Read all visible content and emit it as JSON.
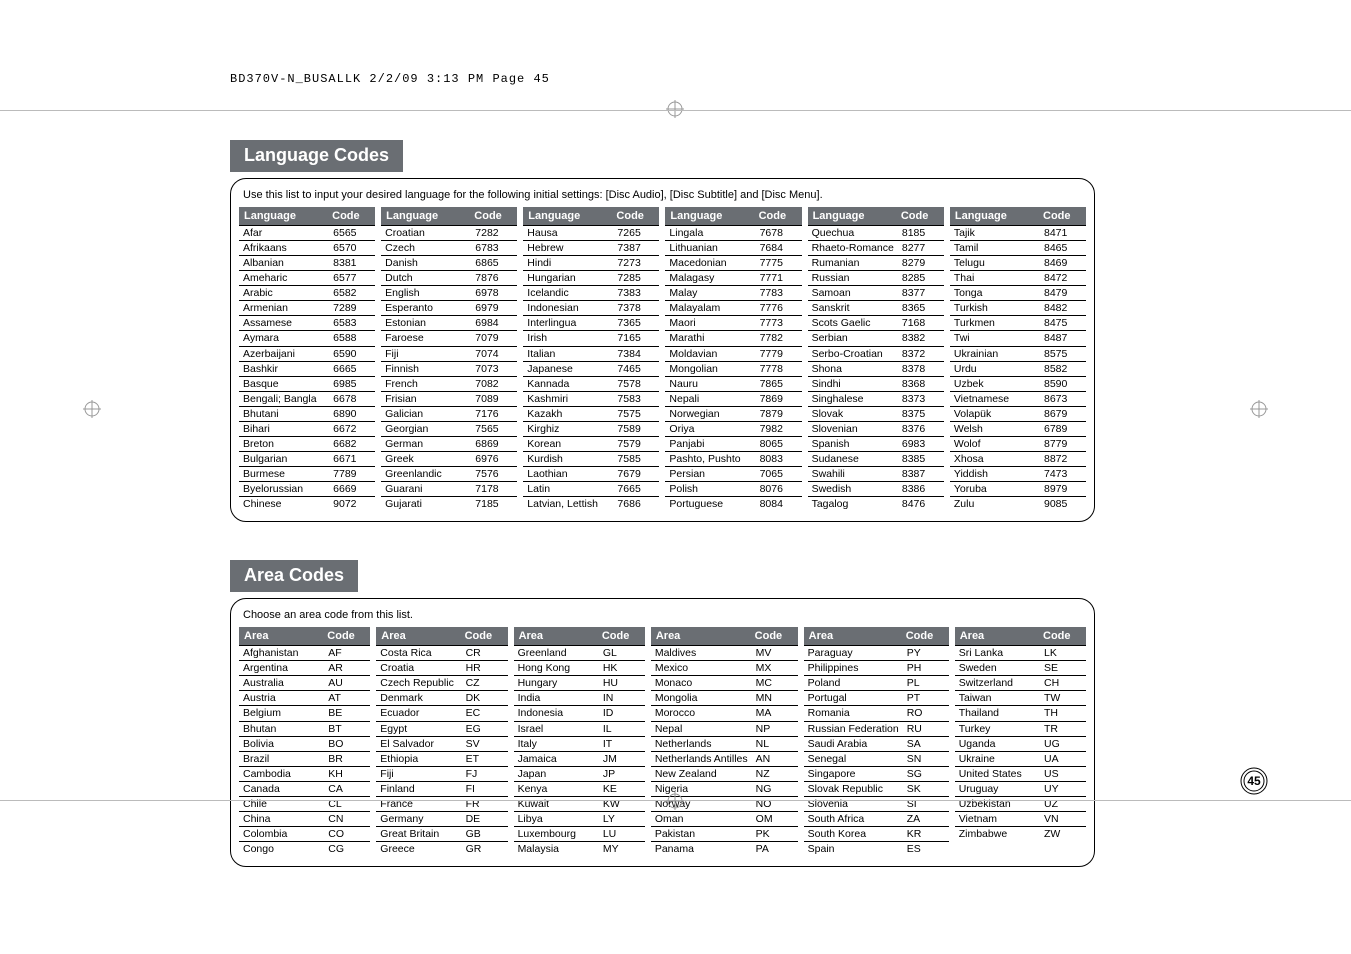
{
  "print_header": "BD370V-N_BUSALLK  2/2/09  3:13 PM  Page 45",
  "page_number": "45",
  "lang_section": {
    "title": "Language Codes",
    "intro": "Use this list to input your desired language for the following initial settings: [Disc Audio], [Disc Subtitle] and [Disc Menu].",
    "header": {
      "c1": "Language",
      "c2": "Code"
    },
    "columns": [
      [
        [
          "Afar",
          "6565"
        ],
        [
          "Afrikaans",
          "6570"
        ],
        [
          "Albanian",
          "8381"
        ],
        [
          "Ameharic",
          "6577"
        ],
        [
          "Arabic",
          "6582"
        ],
        [
          "Armenian",
          "7289"
        ],
        [
          "Assamese",
          "6583"
        ],
        [
          "Aymara",
          "6588"
        ],
        [
          "Azerbaijani",
          "6590"
        ],
        [
          "Bashkir",
          "6665"
        ],
        [
          "Basque",
          "6985"
        ],
        [
          "Bengali; Bangla",
          "6678"
        ],
        [
          "Bhutani",
          "6890"
        ],
        [
          "Bihari",
          "6672"
        ],
        [
          "Breton",
          "6682"
        ],
        [
          "Bulgarian",
          "6671"
        ],
        [
          "Burmese",
          "7789"
        ],
        [
          "Byelorussian",
          "6669"
        ],
        [
          "Chinese",
          "9072"
        ]
      ],
      [
        [
          "Croatian",
          "7282"
        ],
        [
          "Czech",
          "6783"
        ],
        [
          "Danish",
          "6865"
        ],
        [
          "Dutch",
          "7876"
        ],
        [
          "English",
          "6978"
        ],
        [
          "Esperanto",
          "6979"
        ],
        [
          "Estonian",
          "6984"
        ],
        [
          "Faroese",
          "7079"
        ],
        [
          "Fiji",
          "7074"
        ],
        [
          "Finnish",
          "7073"
        ],
        [
          "French",
          "7082"
        ],
        [
          "Frisian",
          "7089"
        ],
        [
          "Galician",
          "7176"
        ],
        [
          "Georgian",
          "7565"
        ],
        [
          "German",
          "6869"
        ],
        [
          "Greek",
          "6976"
        ],
        [
          "Greenlandic",
          "7576"
        ],
        [
          "Guarani",
          "7178"
        ],
        [
          "Gujarati",
          "7185"
        ]
      ],
      [
        [
          "Hausa",
          "7265"
        ],
        [
          "Hebrew",
          "7387"
        ],
        [
          "Hindi",
          "7273"
        ],
        [
          "Hungarian",
          "7285"
        ],
        [
          "Icelandic",
          "7383"
        ],
        [
          "Indonesian",
          "7378"
        ],
        [
          "Interlingua",
          "7365"
        ],
        [
          "Irish",
          "7165"
        ],
        [
          "Italian",
          "7384"
        ],
        [
          "Japanese",
          "7465"
        ],
        [
          "Kannada",
          "7578"
        ],
        [
          "Kashmiri",
          "7583"
        ],
        [
          "Kazakh",
          "7575"
        ],
        [
          "Kirghiz",
          "7589"
        ],
        [
          "Korean",
          "7579"
        ],
        [
          "Kurdish",
          "7585"
        ],
        [
          "Laothian",
          "7679"
        ],
        [
          "Latin",
          "7665"
        ],
        [
          "Latvian, Lettish",
          "7686"
        ]
      ],
      [
        [
          "Lingala",
          "7678"
        ],
        [
          "Lithuanian",
          "7684"
        ],
        [
          "Macedonian",
          "7775"
        ],
        [
          "Malagasy",
          "7771"
        ],
        [
          "Malay",
          "7783"
        ],
        [
          "Malayalam",
          "7776"
        ],
        [
          "Maori",
          "7773"
        ],
        [
          "Marathi",
          "7782"
        ],
        [
          "Moldavian",
          "7779"
        ],
        [
          "Mongolian",
          "7778"
        ],
        [
          "Nauru",
          "7865"
        ],
        [
          "Nepali",
          "7869"
        ],
        [
          "Norwegian",
          "7879"
        ],
        [
          "Oriya",
          "7982"
        ],
        [
          "Panjabi",
          "8065"
        ],
        [
          "Pashto, Pushto",
          "8083"
        ],
        [
          "Persian",
          "7065"
        ],
        [
          "Polish",
          "8076"
        ],
        [
          "Portuguese",
          "8084"
        ]
      ],
      [
        [
          "Quechua",
          "8185"
        ],
        [
          "Rhaeto-Romance",
          "8277"
        ],
        [
          "Rumanian",
          "8279"
        ],
        [
          "Russian",
          "8285"
        ],
        [
          "Samoan",
          "8377"
        ],
        [
          "Sanskrit",
          "8365"
        ],
        [
          "Scots Gaelic",
          "7168"
        ],
        [
          "Serbian",
          "8382"
        ],
        [
          "Serbo-Croatian",
          "8372"
        ],
        [
          "Shona",
          "8378"
        ],
        [
          "Sindhi",
          "8368"
        ],
        [
          "Singhalese",
          "8373"
        ],
        [
          "Slovak",
          "8375"
        ],
        [
          "Slovenian",
          "8376"
        ],
        [
          "Spanish",
          "6983"
        ],
        [
          "Sudanese",
          "8385"
        ],
        [
          "Swahili",
          "8387"
        ],
        [
          "Swedish",
          "8386"
        ],
        [
          "Tagalog",
          "8476"
        ]
      ],
      [
        [
          "Tajik",
          "8471"
        ],
        [
          "Tamil",
          "8465"
        ],
        [
          "Telugu",
          "8469"
        ],
        [
          "Thai",
          "8472"
        ],
        [
          "Tonga",
          "8479"
        ],
        [
          "Turkish",
          "8482"
        ],
        [
          "Turkmen",
          "8475"
        ],
        [
          "Twi",
          "8487"
        ],
        [
          "Ukrainian",
          "8575"
        ],
        [
          "Urdu",
          "8582"
        ],
        [
          "Uzbek",
          "8590"
        ],
        [
          "Vietnamese",
          "8673"
        ],
        [
          "Volapük",
          "8679"
        ],
        [
          "Welsh",
          "6789"
        ],
        [
          "Wolof",
          "8779"
        ],
        [
          "Xhosa",
          "8872"
        ],
        [
          "Yiddish",
          "7473"
        ],
        [
          "Yoruba",
          "8979"
        ],
        [
          "Zulu",
          "9085"
        ]
      ]
    ]
  },
  "area_section": {
    "title": "Area Codes",
    "intro": "Choose an area code from this list.",
    "header": {
      "c1": "Area",
      "c2": "Code"
    },
    "columns": [
      [
        [
          "Afghanistan",
          "AF"
        ],
        [
          "Argentina",
          "AR"
        ],
        [
          "Australia",
          "AU"
        ],
        [
          "Austria",
          "AT"
        ],
        [
          "Belgium",
          "BE"
        ],
        [
          "Bhutan",
          "BT"
        ],
        [
          "Bolivia",
          "BO"
        ],
        [
          "Brazil",
          "BR"
        ],
        [
          "Cambodia",
          "KH"
        ],
        [
          "Canada",
          "CA"
        ],
        [
          "Chile",
          "CL"
        ],
        [
          "China",
          "CN"
        ],
        [
          "Colombia",
          "CO"
        ],
        [
          "Congo",
          "CG"
        ]
      ],
      [
        [
          "Costa Rica",
          "CR"
        ],
        [
          "Croatia",
          "HR"
        ],
        [
          "Czech Republic",
          "CZ"
        ],
        [
          "Denmark",
          "DK"
        ],
        [
          "Ecuador",
          "EC"
        ],
        [
          "Egypt",
          "EG"
        ],
        [
          "El Salvador",
          "SV"
        ],
        [
          "Ethiopia",
          "ET"
        ],
        [
          "Fiji",
          "FJ"
        ],
        [
          "Finland",
          "FI"
        ],
        [
          "France",
          "FR"
        ],
        [
          "Germany",
          "DE"
        ],
        [
          "Great Britain",
          "GB"
        ],
        [
          "Greece",
          "GR"
        ]
      ],
      [
        [
          "Greenland",
          "GL"
        ],
        [
          "Hong Kong",
          "HK"
        ],
        [
          "Hungary",
          "HU"
        ],
        [
          "India",
          "IN"
        ],
        [
          "Indonesia",
          "ID"
        ],
        [
          "Israel",
          "IL"
        ],
        [
          "Italy",
          "IT"
        ],
        [
          "Jamaica",
          "JM"
        ],
        [
          "Japan",
          "JP"
        ],
        [
          "Kenya",
          "KE"
        ],
        [
          "Kuwait",
          "KW"
        ],
        [
          "Libya",
          "LY"
        ],
        [
          "Luxembourg",
          "LU"
        ],
        [
          "Malaysia",
          "MY"
        ]
      ],
      [
        [
          "Maldives",
          "MV"
        ],
        [
          "Mexico",
          "MX"
        ],
        [
          "Monaco",
          "MC"
        ],
        [
          "Mongolia",
          "MN"
        ],
        [
          "Morocco",
          "MA"
        ],
        [
          "Nepal",
          "NP"
        ],
        [
          "Netherlands",
          "NL"
        ],
        [
          "Netherlands Antilles",
          "AN"
        ],
        [
          "New Zealand",
          "NZ"
        ],
        [
          "Nigeria",
          "NG"
        ],
        [
          "Norway",
          "NO"
        ],
        [
          "Oman",
          "OM"
        ],
        [
          "Pakistan",
          "PK"
        ],
        [
          "Panama",
          "PA"
        ]
      ],
      [
        [
          "Paraguay",
          "PY"
        ],
        [
          "Philippines",
          "PH"
        ],
        [
          "Poland",
          "PL"
        ],
        [
          "Portugal",
          "PT"
        ],
        [
          "Romania",
          "RO"
        ],
        [
          "Russian Federation",
          "RU"
        ],
        [
          "Saudi Arabia",
          "SA"
        ],
        [
          "Senegal",
          "SN"
        ],
        [
          "Singapore",
          "SG"
        ],
        [
          "Slovak Republic",
          "SK"
        ],
        [
          "Slovenia",
          "SI"
        ],
        [
          "South Africa",
          "ZA"
        ],
        [
          "South Korea",
          "KR"
        ],
        [
          "Spain",
          "ES"
        ]
      ],
      [
        [
          "Sri Lanka",
          "LK"
        ],
        [
          "Sweden",
          "SE"
        ],
        [
          "Switzerland",
          "CH"
        ],
        [
          "Taiwan",
          "TW"
        ],
        [
          "Thailand",
          "TH"
        ],
        [
          "Turkey",
          "TR"
        ],
        [
          "Uganda",
          "UG"
        ],
        [
          "Ukraine",
          "UA"
        ],
        [
          "United States",
          "US"
        ],
        [
          "Uruguay",
          "UY"
        ],
        [
          "Uzbekistan",
          "UZ"
        ],
        [
          "Vietnam",
          "VN"
        ],
        [
          "Zimbabwe",
          "ZW"
        ]
      ]
    ]
  }
}
